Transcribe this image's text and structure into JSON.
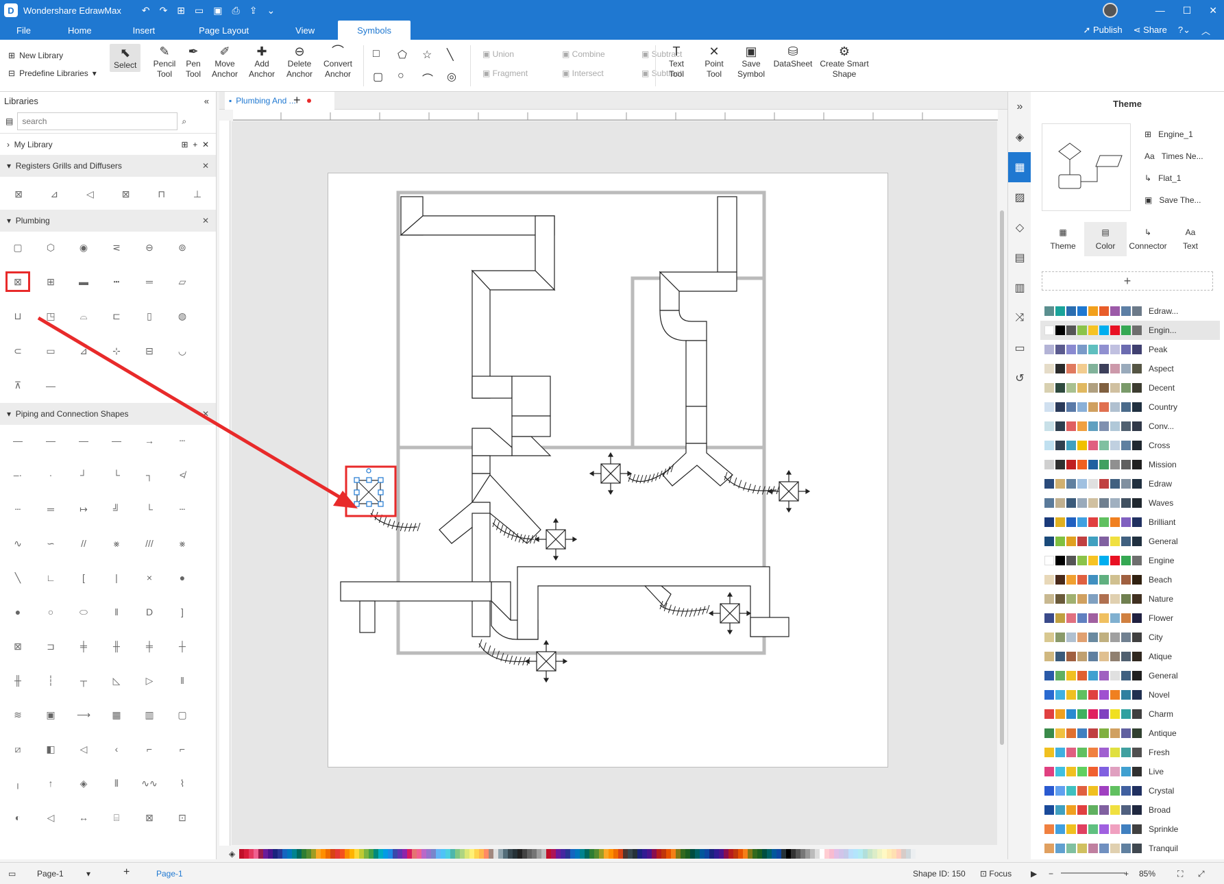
{
  "app": {
    "title": "Wondershare EdrawMax"
  },
  "menu": {
    "tabs": [
      "File",
      "Home",
      "Insert",
      "Page Layout",
      "View",
      "Symbols"
    ],
    "active": "Symbols",
    "publish": "Publish",
    "share": "Share"
  },
  "ribbon": {
    "new_library": "New Library",
    "predefine_libraries": "Predefine Libraries",
    "select": "Select",
    "pencil_tool": "Pencil Tool",
    "pen_tool": "Pen Tool",
    "move_anchor": "Move Anchor",
    "add_anchor": "Add Anchor",
    "delete_anchor": "Delete Anchor",
    "convert_anchor": "Convert Anchor",
    "union": "Union",
    "combine": "Combine",
    "subtract": "Subtract",
    "fragment": "Fragment",
    "intersect": "Intersect",
    "subtract2": "Subtract",
    "text_tool": "Text Tool",
    "point_tool": "Point Tool",
    "save_symbol": "Save Symbol",
    "datasheet": "DataSheet",
    "create_smart_shape": "Create Smart Shape"
  },
  "libraries": {
    "title": "Libraries",
    "search_placeholder": "search",
    "my_library": "My Library",
    "sections": [
      "Registers Grills and Diffusers",
      "Plumbing",
      "Piping and Connection Shapes"
    ]
  },
  "document": {
    "tab_name": "Plumbing And ..."
  },
  "statusbar": {
    "page_select": "Page-1",
    "page_tab": "Page-1",
    "shape_id": "Shape ID: 150",
    "focus": "Focus",
    "zoom": "85%"
  },
  "theme_panel": {
    "title": "Theme",
    "options": [
      "Engine_1",
      "Times Ne...",
      "Flat_1",
      "Save The..."
    ],
    "tabs": [
      "Theme",
      "Color",
      "Connector",
      "Text"
    ],
    "active_tab": "Color",
    "themes": [
      "Edraw...",
      "Engin...",
      "Peak",
      "Aspect",
      "Decent",
      "Country",
      "Conv...",
      "Cross",
      "Mission",
      "Edraw",
      "Waves",
      "Brilliant",
      "General",
      "Engine",
      "Beach",
      "Nature",
      "Flower",
      "City",
      "Atique",
      "General",
      "Novel",
      "Charm",
      "Antique",
      "Fresh",
      "Live",
      "Crystal",
      "Broad",
      "Sprinkle",
      "Tranquil"
    ],
    "active_theme": "Engin..."
  },
  "colors": {
    "brand": "#1f78d1",
    "highlight": "#e82a2a"
  }
}
